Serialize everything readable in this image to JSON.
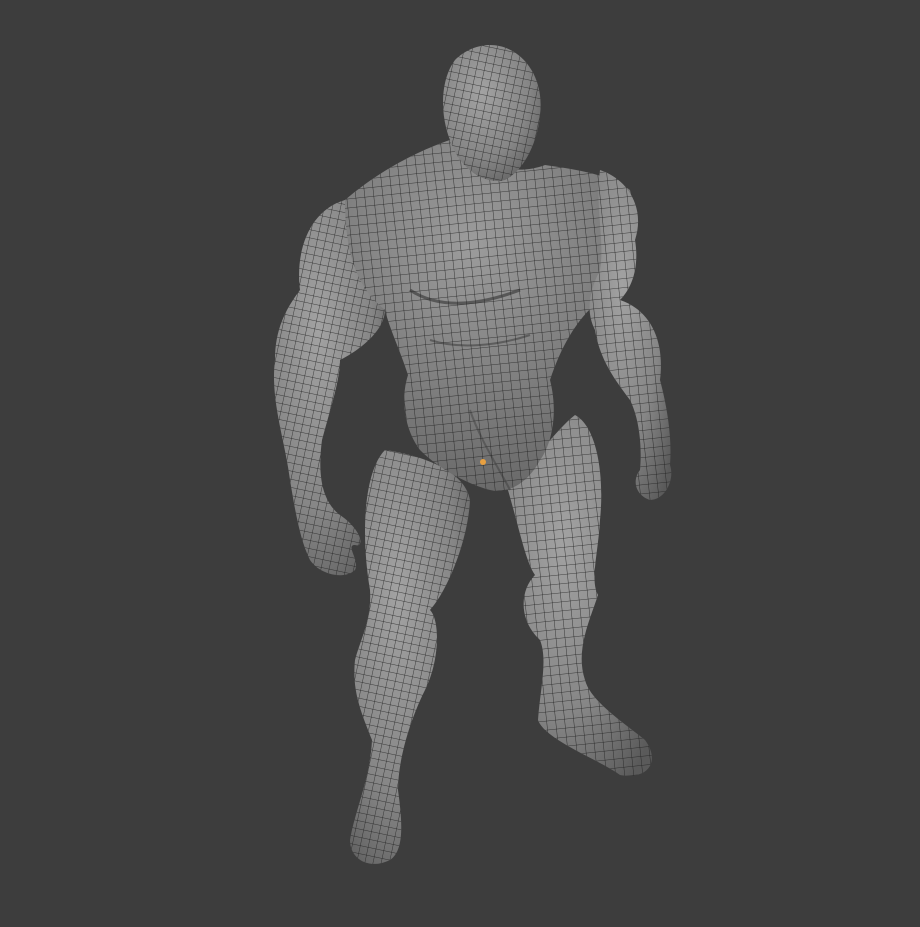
{
  "viewport": {
    "background": "#3d3d3d",
    "mesh_fill": "#8a8a8a",
    "mesh_shadow": "#5e5e5e",
    "wire_color": "#1e1e1e",
    "origin_color": "#e8a040"
  },
  "model": {
    "name": "humanoid-muscular-mesh",
    "display_mode": "wireframe-overlay"
  }
}
